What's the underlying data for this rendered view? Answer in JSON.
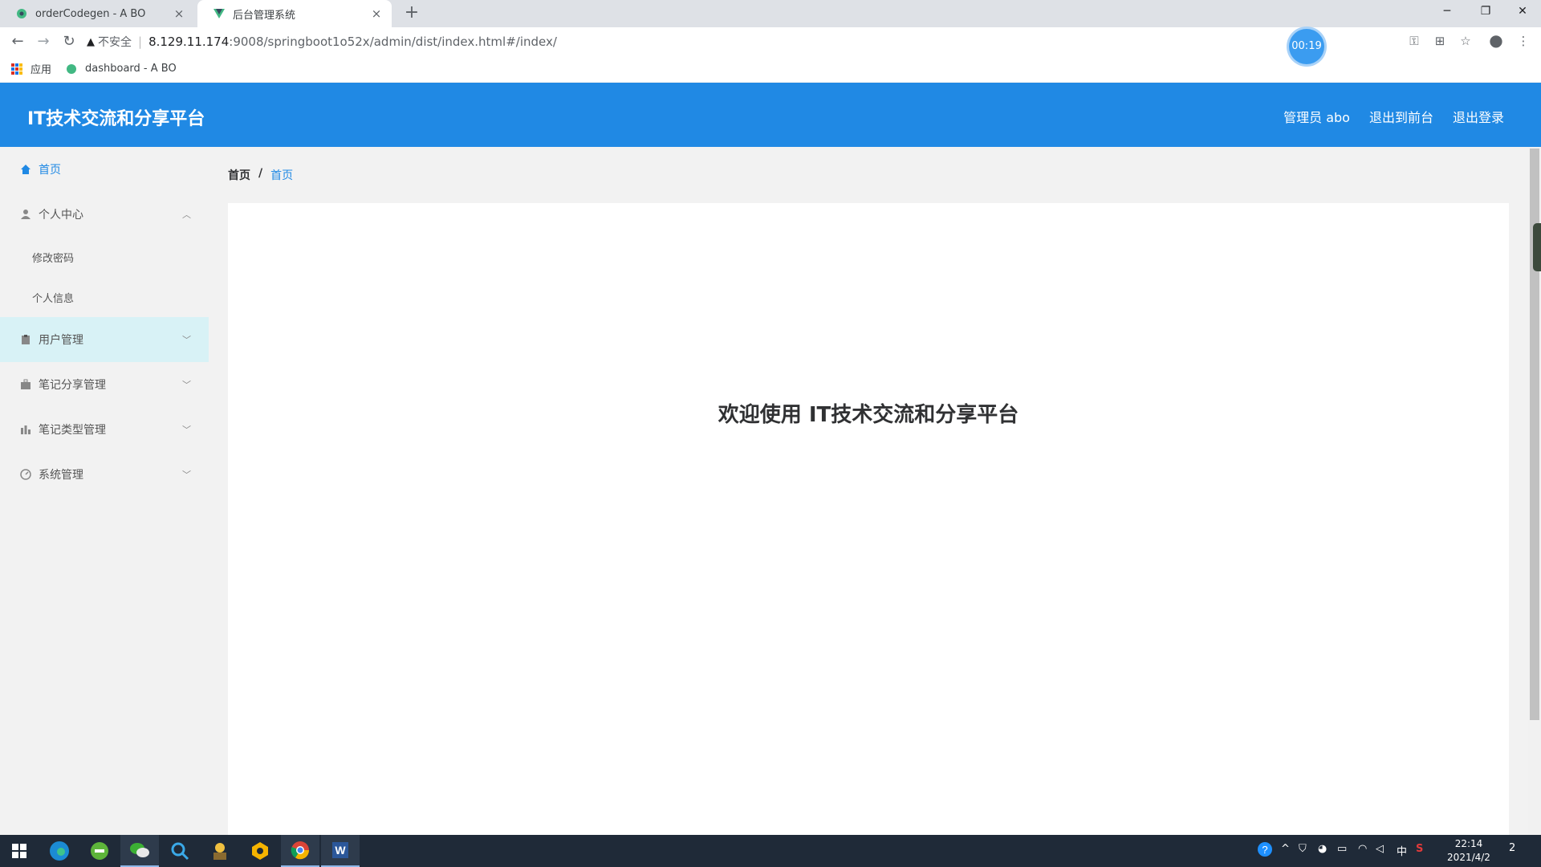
{
  "browser": {
    "tabs": [
      {
        "title": "orderCodegen - A BO",
        "close": "×"
      },
      {
        "title": "后台管理系统",
        "close": "×"
      }
    ],
    "new_tab": "+",
    "window_controls": {
      "minimize": "─",
      "restore": "❐",
      "close": "✕"
    },
    "address": {
      "security_label": "不安全",
      "url_host": "8.129.11.174",
      "url_path": ":9008/springboot1o52x/admin/dist/index.html#/index/"
    },
    "recording_timer": "00:19",
    "bookmarks": [
      {
        "label": "应用",
        "icon": "apps-grid-icon"
      },
      {
        "label": "dashboard - A BO",
        "icon": "site-favicon"
      }
    ]
  },
  "header": {
    "brand": "IT技术交流和分享平台",
    "user_label": "管理员 abo",
    "to_frontend": "退出到前台",
    "logout": "退出登录",
    "color": "#2089e4"
  },
  "sidebar": {
    "home": "首页",
    "personal_center": "个人中心",
    "personal_submenu": [
      "修改密码",
      "个人信息"
    ],
    "user_mgmt": "用户管理",
    "notes_share_mgmt": "笔记分享管理",
    "notes_type_mgmt": "笔记类型管理",
    "system_mgmt": "系统管理"
  },
  "breadcrumb": {
    "first": "首页",
    "separator": "/",
    "current": "首页"
  },
  "main": {
    "welcome": "欢迎使用 IT技术交流和分享平台"
  },
  "taskbar": {
    "clock_time": "22:14",
    "clock_date": "2021/4/2",
    "ime": "中",
    "notifications": "2"
  }
}
